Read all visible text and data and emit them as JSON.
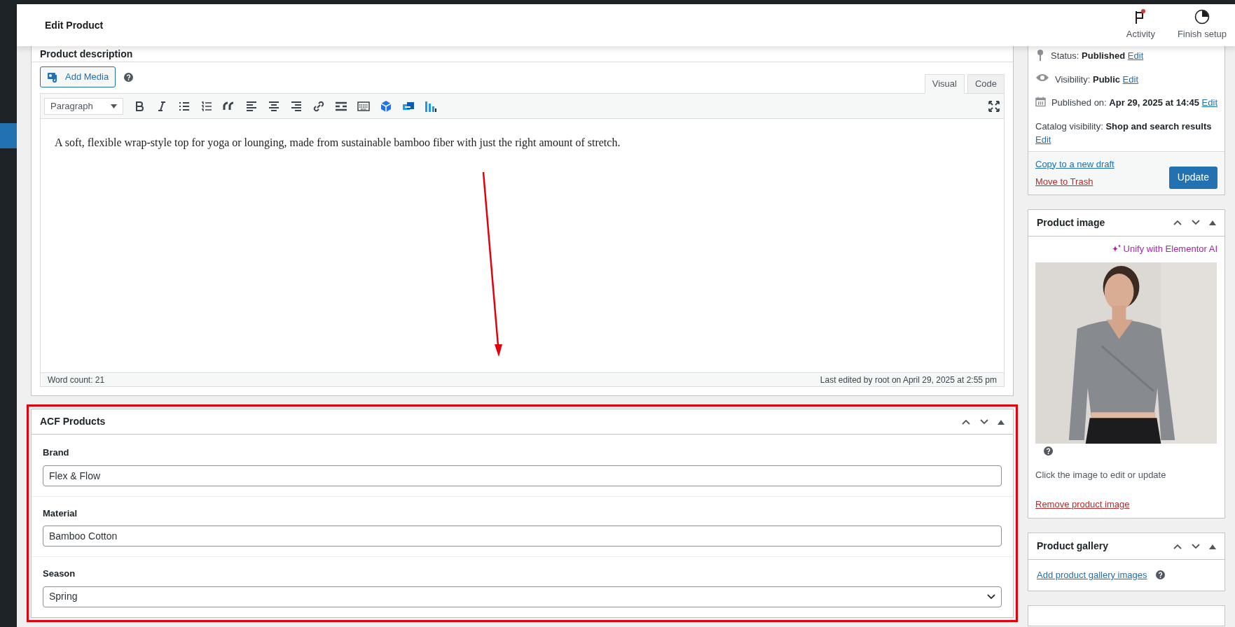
{
  "header": {
    "title": "Edit Product",
    "actions": [
      {
        "label": "Activity",
        "kind": "activity",
        "badge": true
      },
      {
        "label": "Finish setup",
        "kind": "setup"
      }
    ]
  },
  "description_box": {
    "title": "Product description",
    "add_media": "Add Media",
    "tabs": [
      {
        "label": "Visual",
        "selected": true
      },
      {
        "label": "Code",
        "selected": false
      }
    ],
    "format_select": "Paragraph",
    "content": "A soft, flexible wrap-style top for yoga or lounging, made from sustainable bamboo fiber with just the right amount of stretch.",
    "word_count": "Word count: 21",
    "last_edited": "Last edited by root on April 29, 2025 at 2:55 pm"
  },
  "acf_box": {
    "title": "ACF Products",
    "highlighted": true,
    "fields": [
      {
        "label": "Brand",
        "kind": "text",
        "value": "Flex & Flow"
      },
      {
        "label": "Material",
        "kind": "text",
        "value": "Bamboo Cotton"
      },
      {
        "label": "Season",
        "kind": "select",
        "value": "Spring"
      }
    ]
  },
  "publish_box": {
    "rows": [
      {
        "kind": "status",
        "label": "Status:",
        "value": "Published",
        "link": "Edit"
      },
      {
        "kind": "visibility",
        "label": "Visibility:",
        "value": "Public",
        "link": "Edit"
      },
      {
        "kind": "date",
        "label": "Published on:",
        "value": "Apr 29, 2025 at 14:45",
        "link": "Edit"
      },
      {
        "kind": "catalog",
        "label": "Catalog visibility:",
        "value": "Shop and search results",
        "link": "Edit"
      }
    ],
    "copy_link": "Copy to a new draft",
    "trash_link": "Move to Trash",
    "update_button": "Update"
  },
  "image_box": {
    "title": "Product image",
    "ai_link": "Unify with Elementor AI",
    "hint": "Click the image to edit or update",
    "remove_link": "Remove product image"
  },
  "gallery_box": {
    "title": "Product gallery",
    "add_link": "Add product gallery images"
  }
}
